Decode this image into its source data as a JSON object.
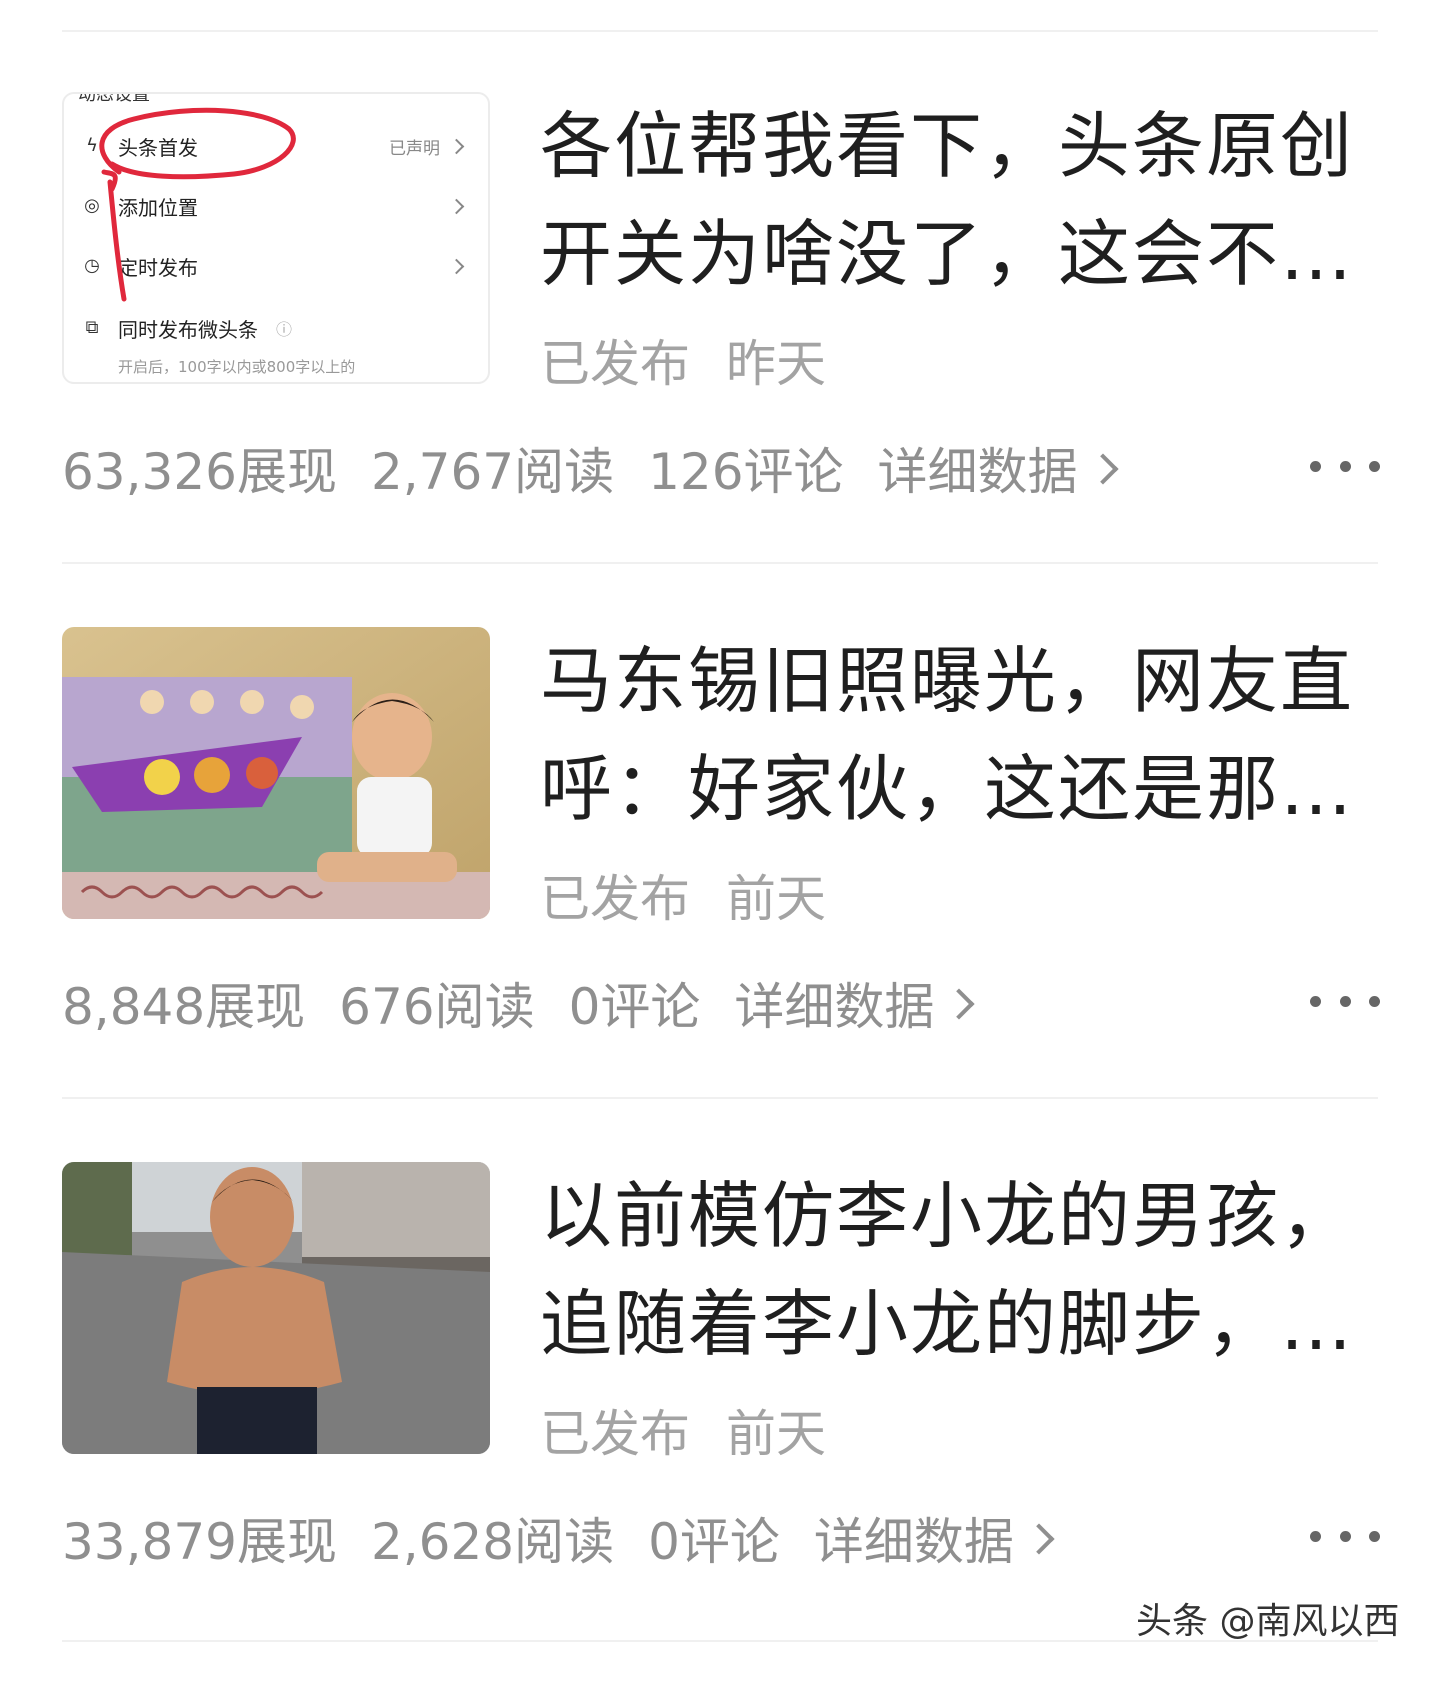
{
  "articles": [
    {
      "title": "各位帮我看下，头条原创开关为啥没了，这会不…",
      "status": "已发布",
      "time": "昨天",
      "impressions": "63,326展现",
      "reads": "2,767阅读",
      "comments": "126评论",
      "detail_label": "详细数据",
      "thumbnail": {
        "kind": "settings-screenshot",
        "top_cut_text": "动态设置",
        "rows": [
          {
            "icon": "lightning-icon",
            "label": "头条首发",
            "value": "已声明"
          },
          {
            "icon": "location-pin-icon",
            "label": "添加位置",
            "value": ""
          },
          {
            "icon": "clock-icon",
            "label": "定时发布",
            "value": ""
          },
          {
            "icon": "copy-icon",
            "label": "同时发布微头条",
            "value": ""
          }
        ],
        "note": "开启后，100字以内或800字以上的",
        "annotation_color": "#e0283c"
      }
    },
    {
      "title": "马东锡旧照曝光，网友直呼：好家伙，这还是那…",
      "status": "已发布",
      "time": "前天",
      "impressions": "8,848展现",
      "reads": "676阅读",
      "comments": "0评论",
      "detail_label": "详细数据",
      "thumbnail": {
        "kind": "photo-child-with-drawing"
      }
    },
    {
      "title": "以前模仿李小龙的男孩，追随着李小龙的脚步，…",
      "status": "已发布",
      "time": "前天",
      "impressions": "33,879展现",
      "reads": "2,628阅读",
      "comments": "0评论",
      "detail_label": "详细数据",
      "thumbnail": {
        "kind": "photo-muscular-boy"
      }
    }
  ],
  "watermark": "头条 @南风以西",
  "colors": {
    "title": "#1f1f1f",
    "meta": "#a3a3a3",
    "stats": "#8f8f8f",
    "divider": "#f0f0f0"
  }
}
